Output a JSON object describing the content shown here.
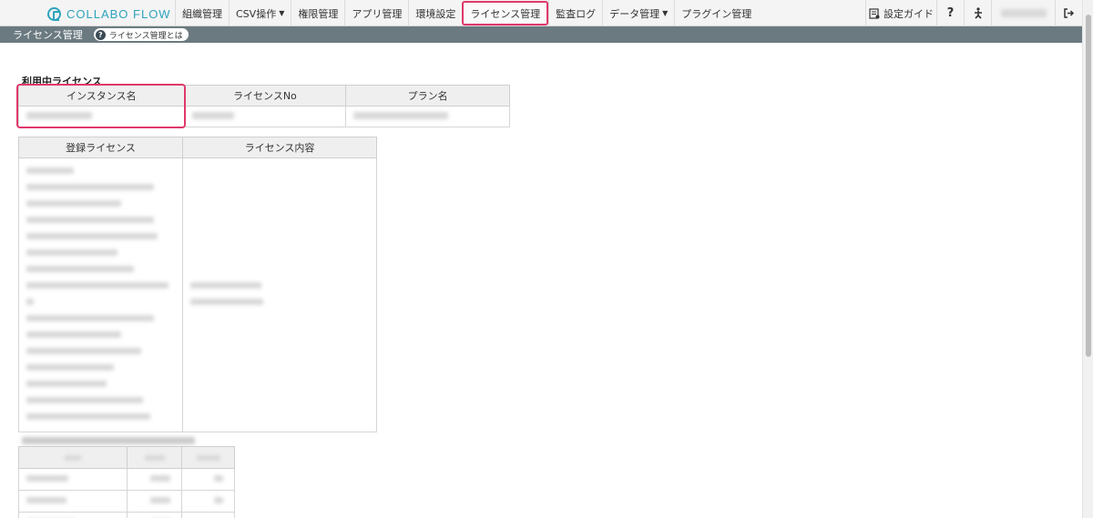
{
  "app": {
    "logo_text": "COLLABO FLOW",
    "brand_color": "#2ea3bd",
    "accent_color": "#e0386b"
  },
  "nav": {
    "items": [
      {
        "label": "組織管理",
        "has_dropdown": false
      },
      {
        "label": "CSV操作",
        "has_dropdown": true
      },
      {
        "label": "権限管理",
        "has_dropdown": false
      },
      {
        "label": "アプリ管理",
        "has_dropdown": false
      },
      {
        "label": "環境設定",
        "has_dropdown": false
      },
      {
        "label": "ライセンス管理",
        "has_dropdown": false,
        "active": true
      },
      {
        "label": "監査ログ",
        "has_dropdown": false
      },
      {
        "label": "データ管理",
        "has_dropdown": true
      },
      {
        "label": "プラグイン管理",
        "has_dropdown": false
      }
    ],
    "guide_label": "設定ガイド",
    "help_icon": "question-icon",
    "accessibility_icon": "accessibility-icon",
    "logout_icon": "logout-icon"
  },
  "subheader": {
    "breadcrumb": "ライセンス管理",
    "help_link": "ライセンス管理とは"
  },
  "license_in_use": {
    "title": "利用中ライセンス",
    "columns": [
      "インスタンス名",
      "ライセンスNo",
      "プラン名"
    ]
  },
  "registered": {
    "columns": [
      "登録ライセンス",
      "ライセンス内容"
    ]
  }
}
